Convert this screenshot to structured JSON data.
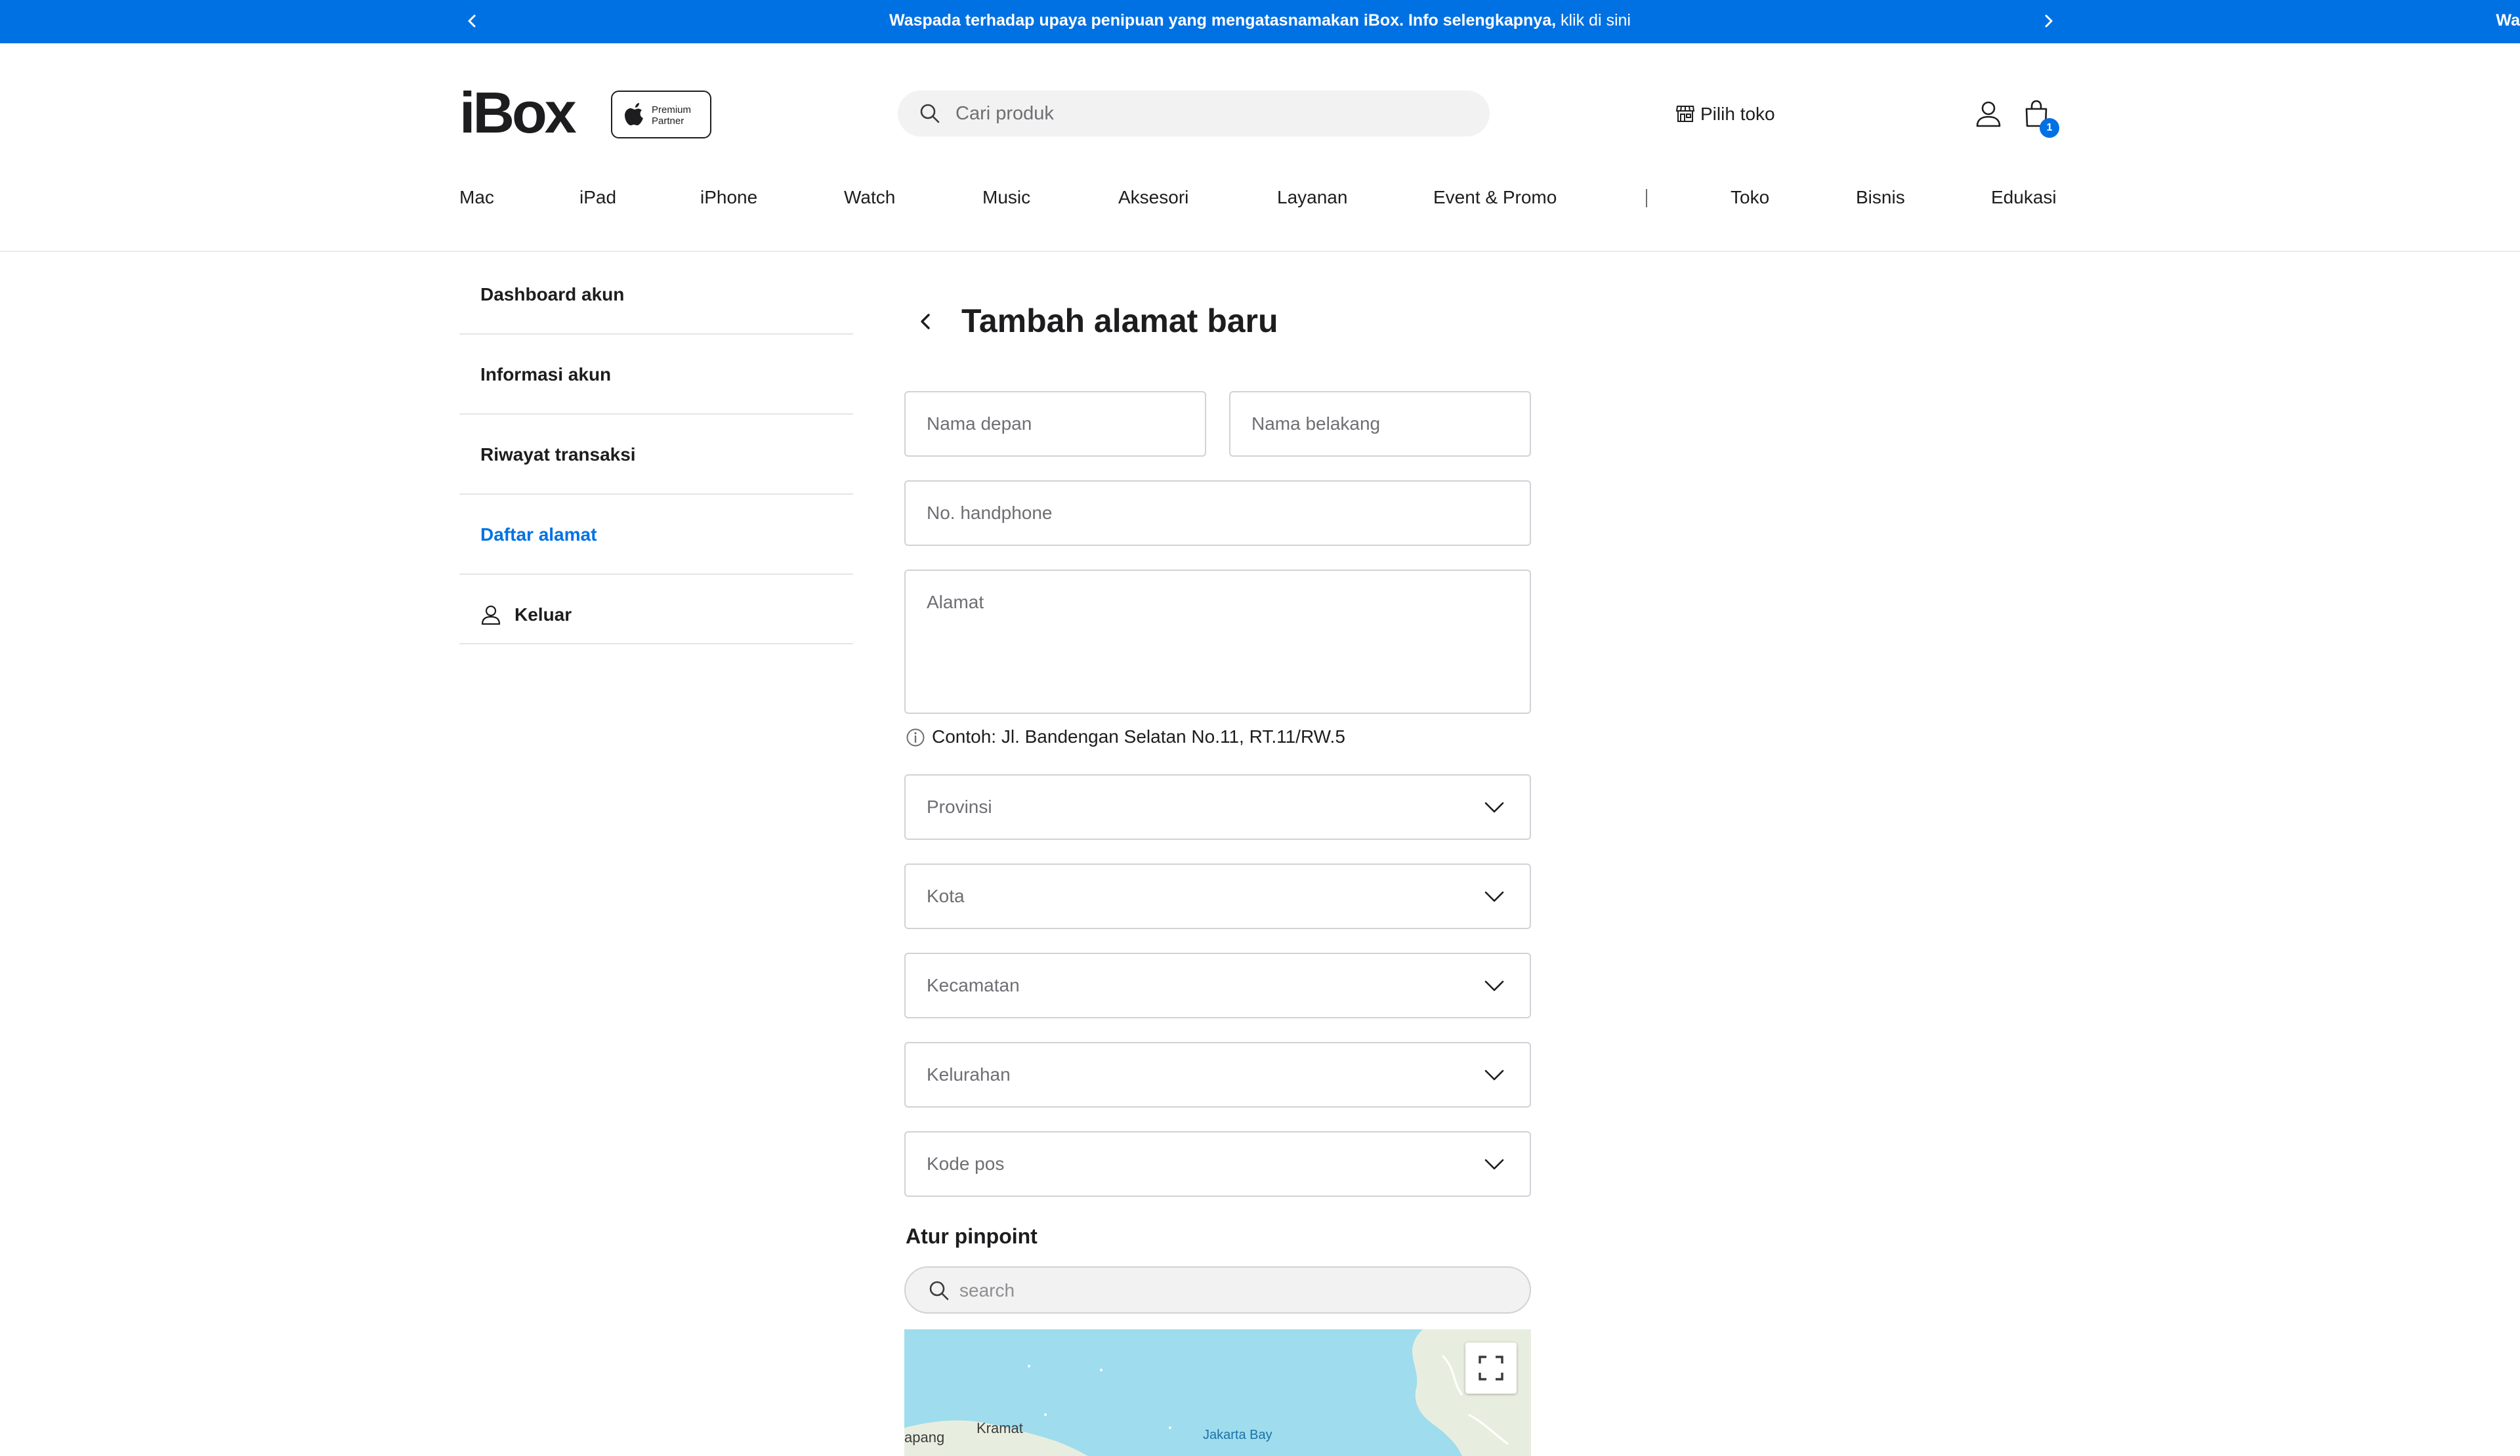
{
  "announcement": {
    "text": "Waspada terhadap upaya penipuan yang mengatasnamakan iBox. Info selengkapnya,",
    "link": " klik di sini",
    "next_peek": "Wa"
  },
  "header": {
    "logo": "iBox",
    "badge_line1": "Premium",
    "badge_line2": "Partner",
    "search_placeholder": "Cari produk",
    "store_label": "Pilih toko",
    "cart_count": "1"
  },
  "nav": {
    "items": [
      "Mac",
      "iPad",
      "iPhone",
      "Watch",
      "Music",
      "Aksesori",
      "Layanan",
      "Event & Promo",
      "Toko",
      "Bisnis",
      "Edukasi"
    ]
  },
  "sidebar": {
    "items": [
      {
        "label": "Dashboard akun",
        "active": false
      },
      {
        "label": "Informasi akun",
        "active": false
      },
      {
        "label": "Riwayat transaksi",
        "active": false
      },
      {
        "label": "Daftar alamat",
        "active": true
      },
      {
        "label": "Keluar",
        "active": false
      }
    ]
  },
  "form": {
    "title": "Tambah alamat baru",
    "first_name_placeholder": "Nama depan",
    "last_name_placeholder": "Nama belakang",
    "phone_placeholder": "No. handphone",
    "address_placeholder": "Alamat",
    "address_hint": "Contoh: Jl. Bandengan Selatan No.11, RT.11/RW.5",
    "province_placeholder": "Provinsi",
    "city_placeholder": "Kota",
    "district_placeholder": "Kecamatan",
    "subdistrict_placeholder": "Kelurahan",
    "postcode_placeholder": "Kode pos"
  },
  "pinpoint": {
    "title": "Atur pinpoint",
    "search_placeholder": "search",
    "map_labels": {
      "place1": "Kramat",
      "place2": "apang",
      "bay": "Jakarta Bay"
    }
  },
  "colors": {
    "accent": "#0071e3",
    "text": "#1d1d1f",
    "muted": "#6e6e73",
    "border": "#d2d2d7",
    "sea": "#9fdced",
    "land": "#e8eedf"
  }
}
